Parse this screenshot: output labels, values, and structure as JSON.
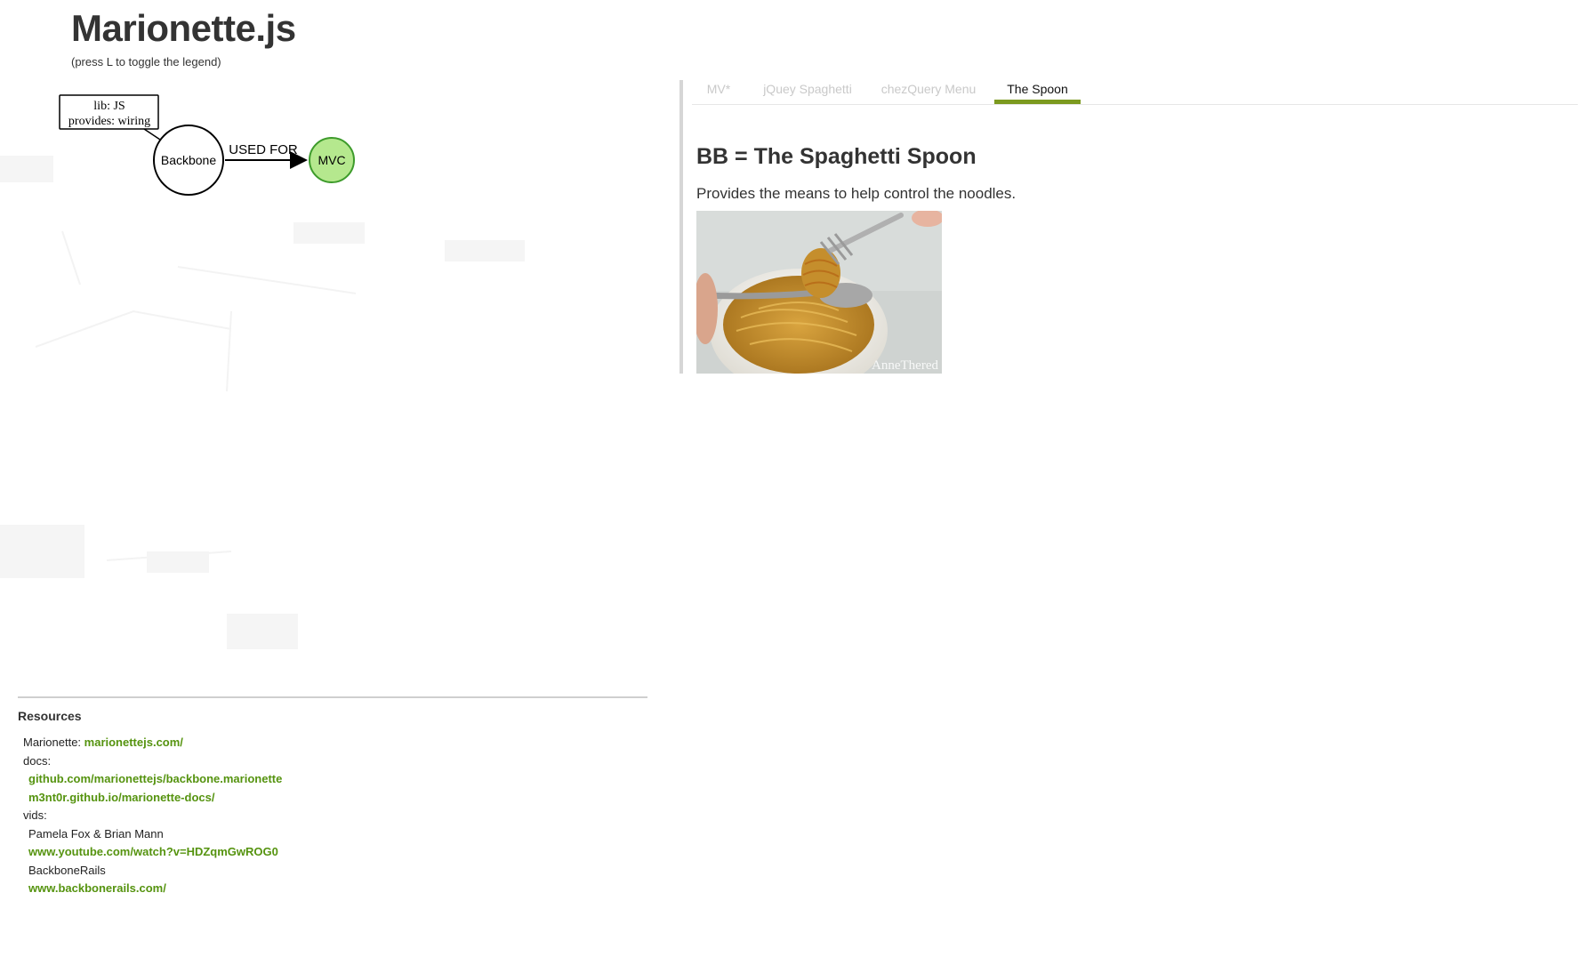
{
  "header": {
    "title": "Marionette.js",
    "legend_hint": "(press L to toggle the legend)"
  },
  "diagram": {
    "callout_line1": "lib: JS",
    "callout_line2": "provides: wiring",
    "node_backbone": "Backbone",
    "edge_label": "USED FOR",
    "node_mvc": "MVC",
    "mvc_color": "#b5e88e"
  },
  "tabs": [
    {
      "label": "MV*",
      "active": false
    },
    {
      "label": "jQuey Spaghetti",
      "active": false
    },
    {
      "label": "chezQuery Menu",
      "active": false
    },
    {
      "label": "The Spoon",
      "active": true
    }
  ],
  "slide": {
    "title": "BB = The Spaghetti Spoon",
    "text": "Provides the means to help control the noodles.",
    "image_watermark": "AnneThered"
  },
  "resources": {
    "title": "Resources",
    "marionette_label": "Marionette: ",
    "marionette_link": "marionettejs.com/",
    "docs_label": "docs:",
    "docs_links": [
      "github.com/marionettejs/backbone.marionette",
      "m3nt0r.github.io/marionette-docs/"
    ],
    "vids_label": "vids:",
    "vids": [
      {
        "name": "Pamela Fox & Brian Mann",
        "link": "www.youtube.com/watch?v=HDZqmGwROG0"
      },
      {
        "name": "BackboneRails",
        "link": "www.backbonerails.com/"
      }
    ]
  },
  "colors": {
    "accent": "#7c9a1f",
    "link": "#55930f"
  }
}
